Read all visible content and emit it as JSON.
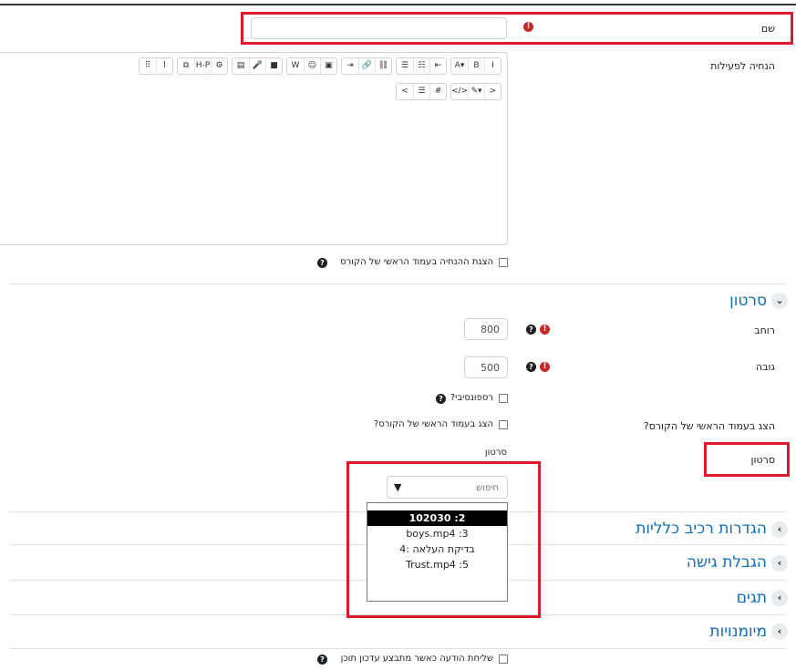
{
  "form": {
    "name_label": "שם",
    "description_label": "הנחיה לפעילות",
    "show_description_label": "הצגת ההנחיה בעמוד הראשי של הקורס"
  },
  "editor": {
    "toolbar_row1": [
      "A▾",
      "B",
      "I",
      "☰",
      "☷",
      "⇤",
      "⇥",
      "🔗",
      "⛓",
      "W",
      "☺",
      "▣",
      "▤",
      "🎤",
      "■",
      "⧉",
      "H-P",
      "⚙",
      "⠿",
      "l"
    ],
    "toolbar_row2": [
      "</>",
      "✎▾",
      ">",
      "<",
      "☰",
      "#"
    ]
  },
  "video_section": {
    "title": "סרטון",
    "width_label": "רוחב",
    "width_value": "800",
    "height_label": "גובה",
    "height_value": "500",
    "responsive_label": "רספונסיבי?",
    "show_main_left_label": "הצג בעמוד הראשי של הקורס?",
    "show_main_right_label": "הצג בעמוד הראשי של הקורס?",
    "video_inner_label": "סרטון",
    "video_outer_label": "סרטון",
    "search_placeholder": "חיפוש",
    "dropdown_arrow": "▼",
    "options": [
      "102030 :2",
      "boys.mp4 :3",
      "בדיקת העלאה :4",
      "Trust.mp4 :5"
    ],
    "selected_index": 0
  },
  "sections": [
    {
      "title": "הגדרות רכיב כלליות"
    },
    {
      "title": "הגבלת גישה"
    },
    {
      "title": "תגים"
    },
    {
      "title": "מיומנויות"
    }
  ],
  "footer": {
    "notify_label": "שליחת הודעה כאשר מתבצע עדכון תוכן"
  },
  "colors": {
    "highlight": "#e1172b",
    "link": "#0f6cbf",
    "error": "#c62828"
  }
}
